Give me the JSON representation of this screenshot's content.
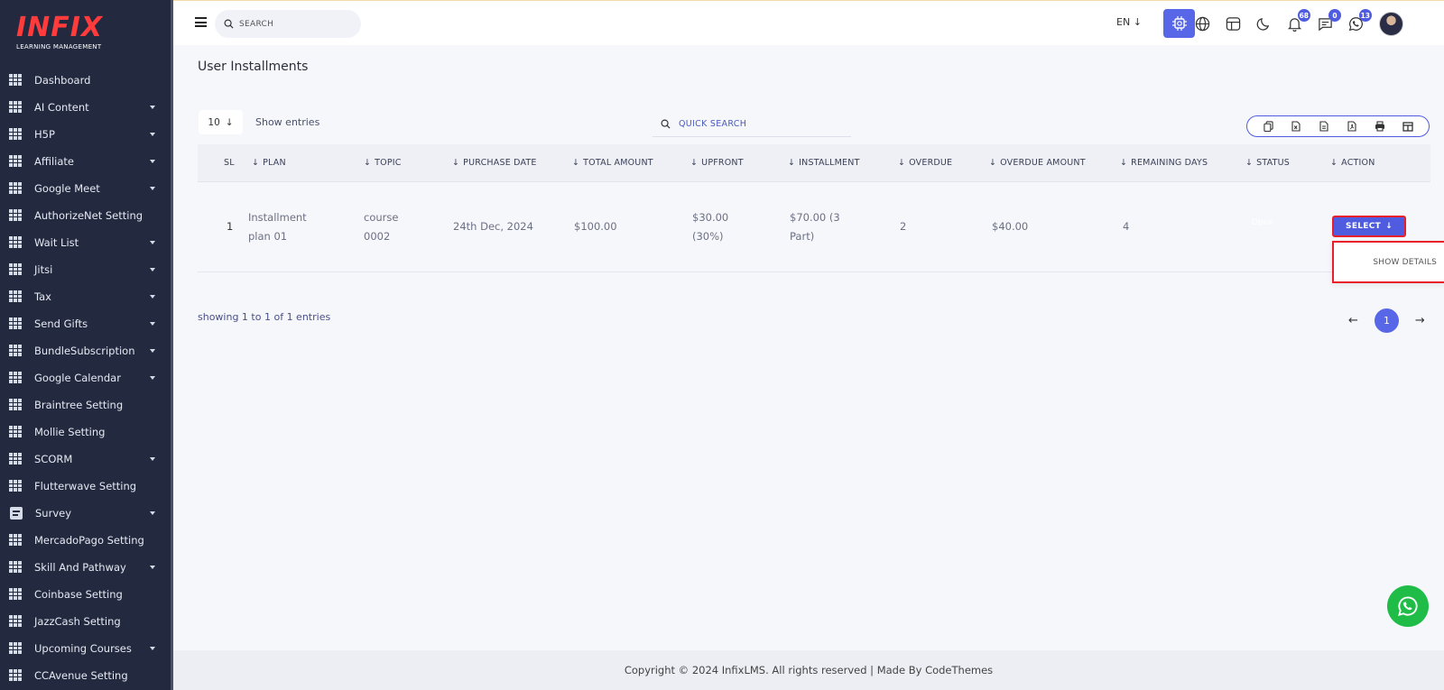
{
  "brand": {
    "logo": "INFIX",
    "tagline": "LEARNING MANAGEMENT"
  },
  "sidebar": {
    "items": [
      {
        "label": "Dashboard",
        "caret": false,
        "icon": "grid-icon"
      },
      {
        "label": "AI Content",
        "caret": true,
        "icon": "grid-icon"
      },
      {
        "label": "H5P",
        "caret": true,
        "icon": "grid-icon"
      },
      {
        "label": "Affiliate",
        "caret": true,
        "icon": "grid-icon"
      },
      {
        "label": "Google Meet",
        "caret": true,
        "icon": "grid-icon"
      },
      {
        "label": "AuthorizeNet Setting",
        "caret": false,
        "icon": "grid-icon"
      },
      {
        "label": "Wait List",
        "caret": true,
        "icon": "grid-icon"
      },
      {
        "label": "Jitsi",
        "caret": true,
        "icon": "grid-icon"
      },
      {
        "label": "Tax",
        "caret": true,
        "icon": "grid-icon"
      },
      {
        "label": "Send Gifts",
        "caret": true,
        "icon": "grid-icon"
      },
      {
        "label": "BundleSubscription",
        "caret": true,
        "icon": "grid-icon"
      },
      {
        "label": "Google Calendar",
        "caret": true,
        "icon": "grid-icon"
      },
      {
        "label": "Braintree Setting",
        "caret": false,
        "icon": "grid-icon"
      },
      {
        "label": "Mollie Setting",
        "caret": false,
        "icon": "grid-icon"
      },
      {
        "label": "SCORM",
        "caret": true,
        "icon": "grid-icon"
      },
      {
        "label": "Flutterwave Setting",
        "caret": false,
        "icon": "grid-icon"
      },
      {
        "label": "Survey",
        "caret": true,
        "icon": "document-icon"
      },
      {
        "label": "MercadoPago Setting",
        "caret": false,
        "icon": "grid-icon"
      },
      {
        "label": "Skill And Pathway",
        "caret": true,
        "icon": "grid-icon"
      },
      {
        "label": "Coinbase Setting",
        "caret": false,
        "icon": "grid-icon"
      },
      {
        "label": "JazzCash Setting",
        "caret": false,
        "icon": "grid-icon"
      },
      {
        "label": "Upcoming Courses",
        "caret": true,
        "icon": "grid-icon"
      },
      {
        "label": "CCAvenue Setting",
        "caret": false,
        "icon": "grid-icon"
      }
    ]
  },
  "header": {
    "search_placeholder": "SEARCH",
    "language": "EN",
    "notifications_count": "68",
    "messages_count": "0",
    "whatsapp_count": "13"
  },
  "page": {
    "title": "User Installments",
    "entries_value": "10",
    "entries_label": "Show entries",
    "quick_search_placeholder": "QUICK SEARCH",
    "showing_text": "showing 1 to 1 of 1 entries",
    "current_page": "1"
  },
  "table": {
    "headers": [
      "SL",
      "PLAN",
      "TOPIC",
      "PURCHASE DATE",
      "TOTAL AMOUNT",
      "UPFRONT",
      "INSTALLMENT",
      "OVERDUE",
      "OVERDUE AMOUNT",
      "REMAINING DAYS",
      "STATUS",
      "ACTION"
    ],
    "rows": [
      {
        "sl": "1",
        "plan_line1": "Installment",
        "plan_line2": "plan 01",
        "topic_line1": "course",
        "topic_line2": "0002",
        "purchase_date": "24th Dec, 2024",
        "total_amount": "$100.00",
        "upfront_line1": "$30.00",
        "upfront_line2": "(30%)",
        "installment_line1": "$70.00 (3",
        "installment_line2": "Part)",
        "overdue": "2",
        "overdue_amount": "$40.00",
        "remaining_days": "4",
        "status": "Open",
        "action_label": "SELECT"
      }
    ],
    "dropdown_option": "SHOW DETAILS"
  },
  "footer": {
    "text": "Copyright © 2024 InfixLMS. All rights reserved | Made By CodeThemes"
  },
  "colors": {
    "sidebar_bg": "#232a40",
    "accent": "#5867e8",
    "logo_red": "#ff3b3b",
    "highlight_red": "#e81e2b",
    "whatsapp_green": "#1fbd47"
  }
}
